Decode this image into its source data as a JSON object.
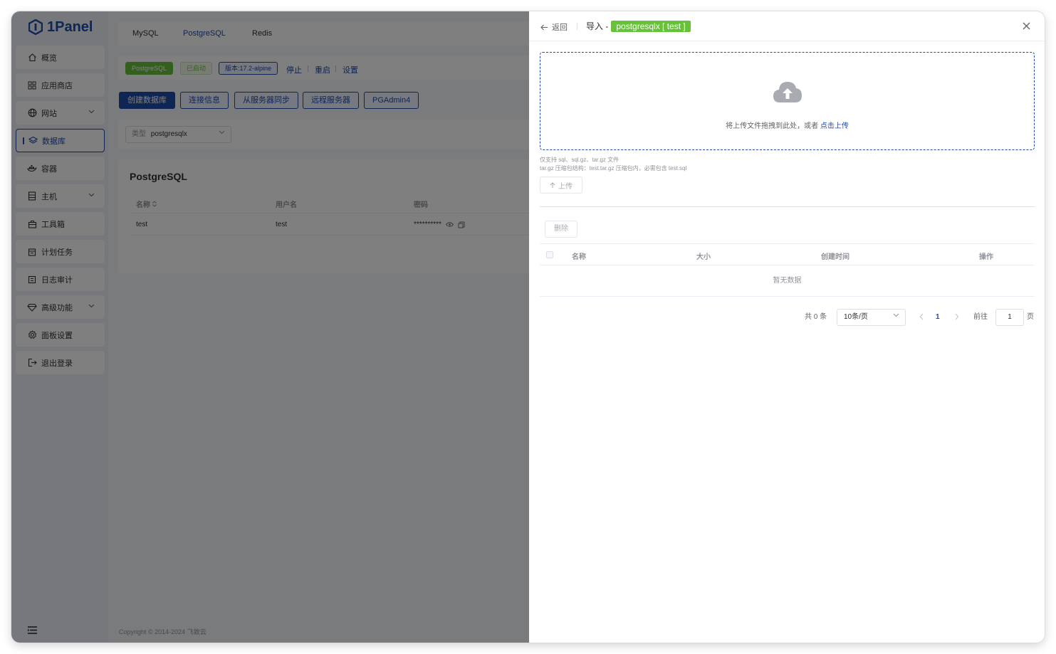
{
  "app": {
    "logo_text": "1Panel"
  },
  "sidebar": {
    "items": [
      {
        "label": "概览",
        "icon": "home-icon"
      },
      {
        "label": "应用商店",
        "icon": "grid-icon"
      },
      {
        "label": "网站",
        "icon": "globe-icon",
        "expandable": true
      },
      {
        "label": "数据库",
        "icon": "layers-icon",
        "active": true
      },
      {
        "label": "容器",
        "icon": "docker-icon"
      },
      {
        "label": "主机",
        "icon": "server-icon",
        "expandable": true
      },
      {
        "label": "工具箱",
        "icon": "toolbox-icon"
      },
      {
        "label": "计划任务",
        "icon": "calendar-icon"
      },
      {
        "label": "日志审计",
        "icon": "log-icon"
      },
      {
        "label": "高级功能",
        "icon": "diamond-icon",
        "expandable": true
      },
      {
        "label": "面板设置",
        "icon": "gear-icon"
      },
      {
        "label": "退出登录",
        "icon": "logout-icon"
      }
    ]
  },
  "main": {
    "tabs": [
      "MySQL",
      "PostgreSQL",
      "Redis"
    ],
    "active_tab": "PostgreSQL",
    "status": {
      "app_tag": "PostgreSQL",
      "state_tag": "已启动",
      "version_tag": "版本:17.2-alpine",
      "actions": [
        "停止",
        "重启",
        "设置"
      ]
    },
    "buttons": [
      "创建数据库",
      "连接信息",
      "从服务器同步",
      "远程服务器",
      "PGAdmin4"
    ],
    "filter": {
      "label": "类型",
      "value": "postgresqlx"
    },
    "table": {
      "title": "PostgreSQL",
      "headers": [
        "名称",
        "用户名",
        "密码"
      ],
      "rows": [
        {
          "name": "test",
          "user": "test",
          "password": "**********"
        }
      ]
    },
    "footer": "Copyright © 2014-2024 飞致云"
  },
  "drawer": {
    "back_label": "返回",
    "title_prefix": "导入 -",
    "title_tag": "postgresqlx [ test ]",
    "upload": {
      "text": "将上传文件拖拽到此处，或者",
      "click_text": "点击上传"
    },
    "hint_1": "仅支持 sql、sql.gz、tar.gz 文件",
    "hint_2": "tar.gz 压缩包结构：test.tar.gz 压缩包内，必需包含 test.sql",
    "upload_button": "上传",
    "delete_button": "删除",
    "columns": [
      "名称",
      "大小",
      "创建时间",
      "操作"
    ],
    "empty_text": "暂无数据",
    "pagination": {
      "total": "共 0 条",
      "page_size": "10条/页",
      "current_page": "1",
      "goto_label": "前往",
      "goto_value": "1",
      "page_unit": "页"
    }
  },
  "colors": {
    "primary": "#1f4aa8",
    "success": "#67c23a"
  }
}
